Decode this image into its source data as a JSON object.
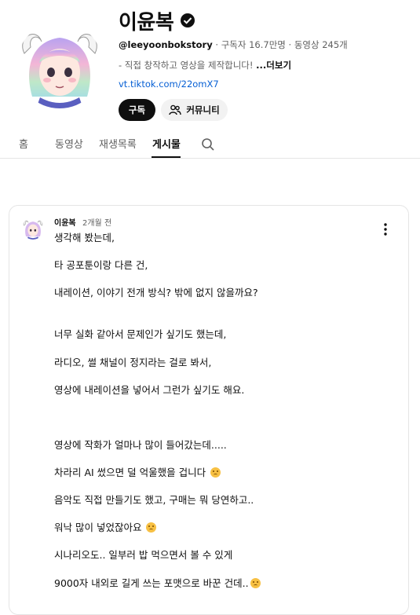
{
  "channel": {
    "name": "이윤복",
    "handle": "@leeyoonbokstory",
    "subscribers": "구독자 16.7만명",
    "video_count": "동영상 245개",
    "description": "- 직접 창작하고 영상을 제작합니다!",
    "more_label": "...더보기",
    "link": "vt.tiktok.com/22omX7",
    "subscribe_label": "구독",
    "community_label": "커뮤니티"
  },
  "tabs": [
    {
      "label": "홈"
    },
    {
      "label": "동영상"
    },
    {
      "label": "재생목록"
    },
    {
      "label": "게시물",
      "active": true
    }
  ],
  "post": {
    "author": "이윤복",
    "time": "2개월 전",
    "lines": [
      "생각해 봤는데,",
      "타 공포툰이랑 다른 건,",
      "내레이션, 이야기 전개 방식? 밖에 없지 않을까요?",
      "너무 실화 같아서  문제인가 싶기도 했는데,",
      "라디오, 썰 채널이 정지라는 걸로 봐서,",
      "영상에 내레이션을 넣어서 그런가 싶기도 해요.",
      "영상에 작화가 얼마나 많이 들어갔는데.....",
      "차라리 AI 썼으면 덜 억울했을 겁니다",
      "음악도 직접 만들기도 했고, 구매는 뭐 당연하고..",
      "워낙 많이 넣었잖아요",
      "시나리오도.. 일부러 밥 먹으면서 볼 수 있게",
      "9000자 내외로 길게 쓰는 포맷으로 바꾼 건데.."
    ]
  },
  "colors": {
    "text": "#0f0f0f",
    "secondary": "#606060",
    "link": "#065fd4",
    "subscribe_bg": "#0f0f0f",
    "chip_bg": "#f2f2f2"
  }
}
